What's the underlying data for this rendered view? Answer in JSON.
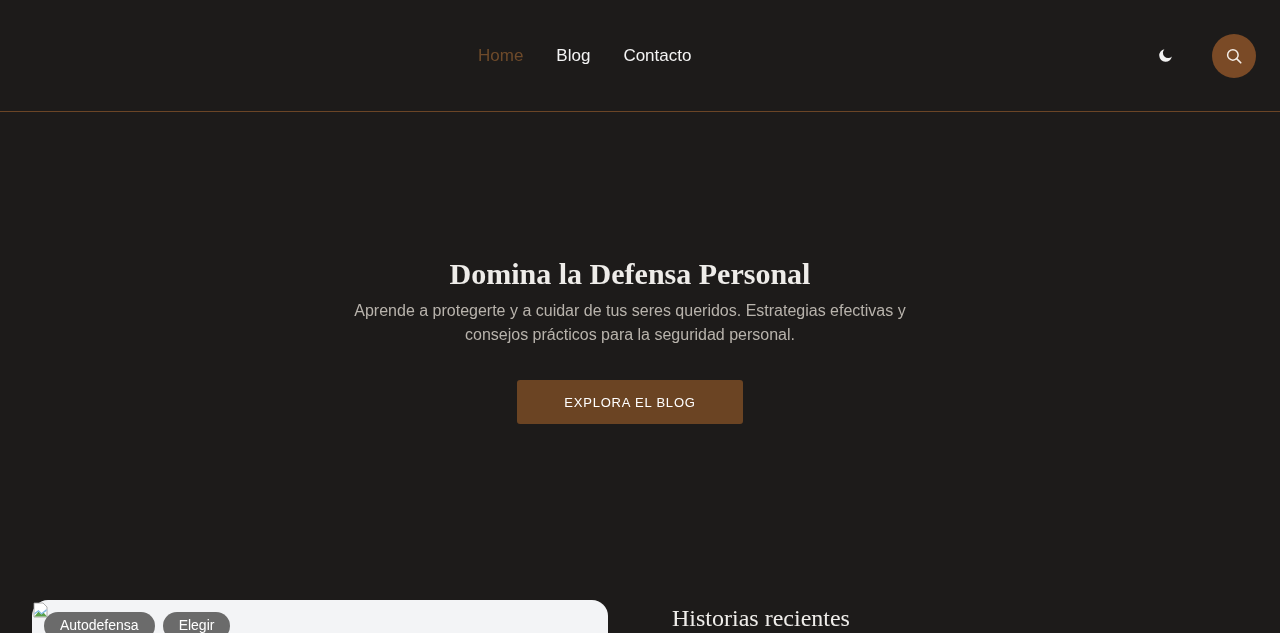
{
  "header": {
    "nav": [
      {
        "label": "Home",
        "selected": true
      },
      {
        "label": "Blog",
        "selected": false
      },
      {
        "label": "Contacto",
        "selected": false
      }
    ]
  },
  "hero": {
    "title": "Domina la Defensa Personal",
    "subtitle": "Aprende a protegerte y a cuidar de tus seres queridos. Estrategias efectivas y consejos prácticos para la seguridad personal.",
    "button": "EXPLORA EL BLOG"
  },
  "featured_post": {
    "tags": [
      "Autodefensa",
      "Elegir"
    ]
  },
  "recent": {
    "title": "Historias recientes"
  }
}
